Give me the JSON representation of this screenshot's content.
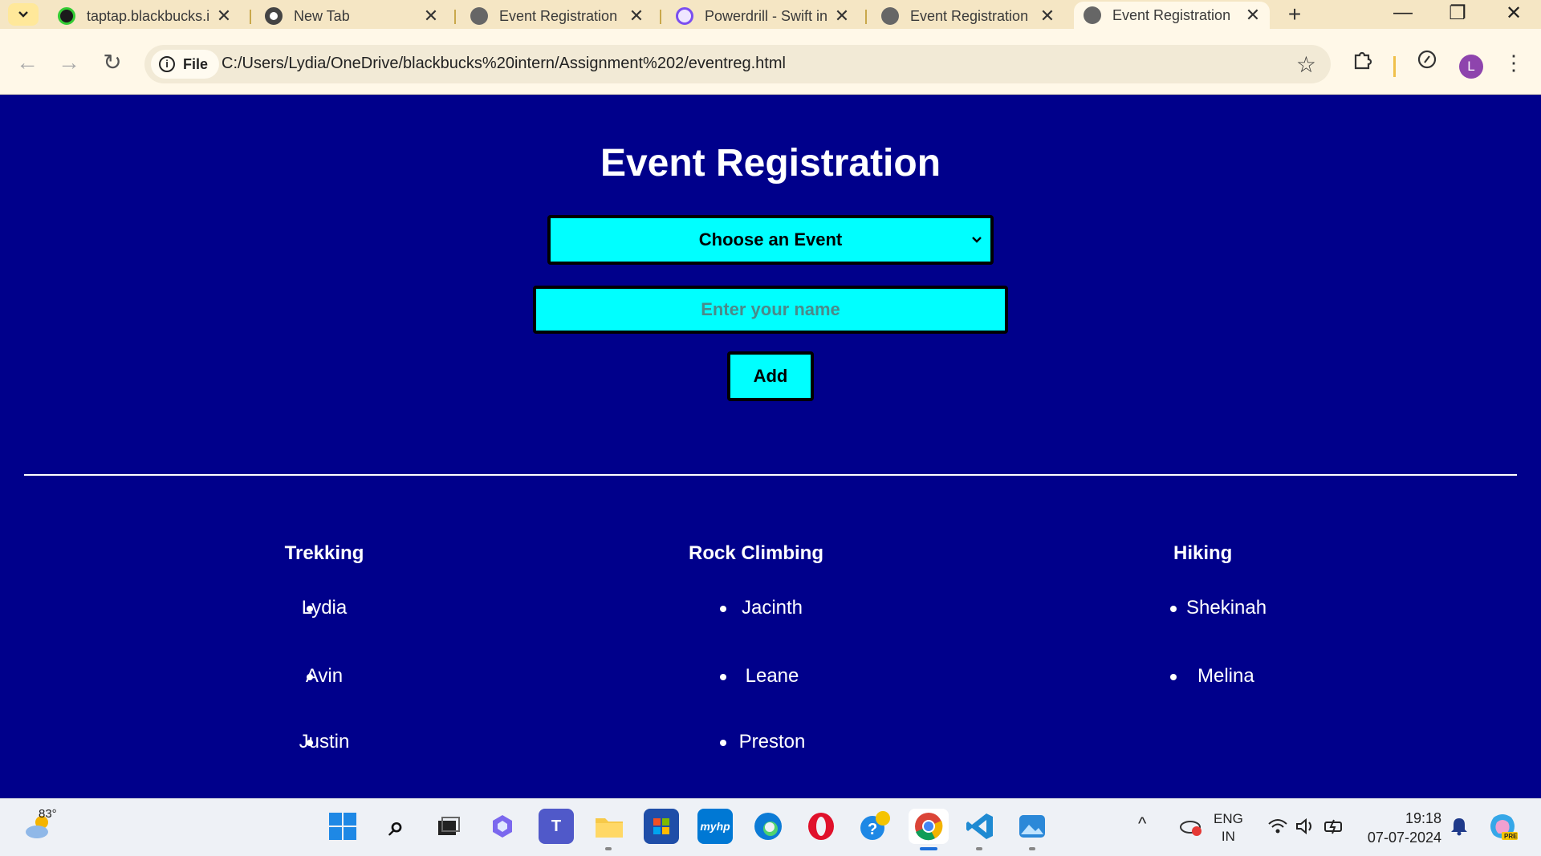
{
  "browser": {
    "tabs": [
      {
        "title": "taptap.blackbucks.i",
        "active": false
      },
      {
        "title": "New Tab",
        "active": false
      },
      {
        "title": "Event Registration",
        "active": false
      },
      {
        "title": "Powerdrill - Swift in",
        "active": false
      },
      {
        "title": "Event Registration",
        "active": false
      },
      {
        "title": "Event Registration",
        "active": true
      }
    ],
    "site_chip": "File",
    "url": "C:/Users/Lydia/OneDrive/blackbucks%20intern/Assignment%202/eventreg.html",
    "avatar_letter": "L"
  },
  "page": {
    "title": "Event Registration",
    "select_label": "Choose an Event",
    "name_placeholder": "Enter your name",
    "add_label": "Add",
    "events": [
      {
        "name": "Trekking",
        "participants": [
          "Lydia",
          "Avin",
          "Justin"
        ]
      },
      {
        "name": "Rock Climbing",
        "participants": [
          "Jacinth",
          "Leane",
          "Preston"
        ]
      },
      {
        "name": "Hiking",
        "participants": [
          "Shekinah",
          "Melina"
        ]
      }
    ]
  },
  "taskbar": {
    "weather_temp": "83°",
    "language": "ENG",
    "region": "IN",
    "time": "19:18",
    "date": "07-07-2024"
  },
  "colors": {
    "page_bg": "#00008b",
    "control_bg": "#00ffff"
  }
}
